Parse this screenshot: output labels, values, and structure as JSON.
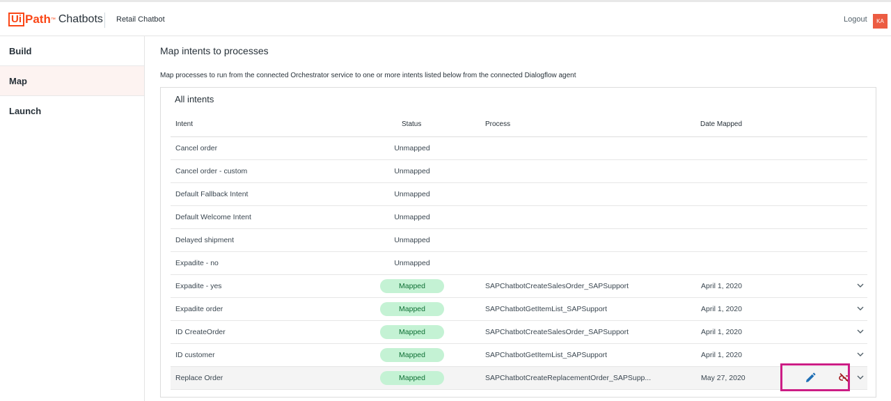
{
  "header": {
    "logo_ui": "Ui",
    "logo_path": "Path",
    "logo_tm": "™",
    "logo_product": "Chatbots",
    "app_name": "Retail Chatbot",
    "logout_label": "Logout",
    "avatar_initials": "KA"
  },
  "sidebar": {
    "items": [
      {
        "label": "Build"
      },
      {
        "label": "Map"
      },
      {
        "label": "Launch"
      }
    ]
  },
  "main": {
    "title": "Map intents to processes",
    "description": "Map processes to run from the connected Orchestrator service to one or more intents listed below from the connected Dialogflow agent"
  },
  "table": {
    "title": "All intents",
    "columns": {
      "intent": "Intent",
      "status": "Status",
      "process": "Process",
      "date": "Date Mapped"
    },
    "rows": [
      {
        "intent": "Cancel order",
        "status": "Unmapped",
        "process": "",
        "date": ""
      },
      {
        "intent": "Cancel order - custom",
        "status": "Unmapped",
        "process": "",
        "date": ""
      },
      {
        "intent": "Default Fallback Intent",
        "status": "Unmapped",
        "process": "",
        "date": ""
      },
      {
        "intent": "Default Welcome Intent",
        "status": "Unmapped",
        "process": "",
        "date": ""
      },
      {
        "intent": "Delayed shipment",
        "status": "Unmapped",
        "process": "",
        "date": ""
      },
      {
        "intent": "Expadite - no",
        "status": "Unmapped",
        "process": "",
        "date": ""
      },
      {
        "intent": "Expadite - yes",
        "status": "Mapped",
        "process": "SAPChatbotCreateSalesOrder_SAPSupport",
        "date": "April 1, 2020"
      },
      {
        "intent": "Expadite order",
        "status": "Mapped",
        "process": "SAPChatbotGetItemList_SAPSupport",
        "date": "April 1, 2020"
      },
      {
        "intent": "ID CreateOrder",
        "status": "Mapped",
        "process": "SAPChatbotCreateSalesOrder_SAPSupport",
        "date": "April 1, 2020"
      },
      {
        "intent": "ID customer",
        "status": "Mapped",
        "process": "SAPChatbotGetItemList_SAPSupport",
        "date": "April 1, 2020"
      },
      {
        "intent": "Replace Order",
        "status": "Mapped",
        "process": "SAPChatbotCreateReplacementOrder_SAPSupp...",
        "date": "May 27, 2020"
      }
    ]
  },
  "icons": {
    "edit": "pencil-icon",
    "unlink": "unlink-icon",
    "expand": "chevron-down-icon"
  },
  "colors": {
    "brand": "#fa4616",
    "mapped_badge_bg": "#c4f2d4",
    "mapped_badge_text": "#0d6e33",
    "highlight_box": "#cc1d85",
    "edit_icon": "#1f6fb5",
    "unlink_icon": "#a0161b",
    "avatar_bg": "#ec5c42"
  }
}
